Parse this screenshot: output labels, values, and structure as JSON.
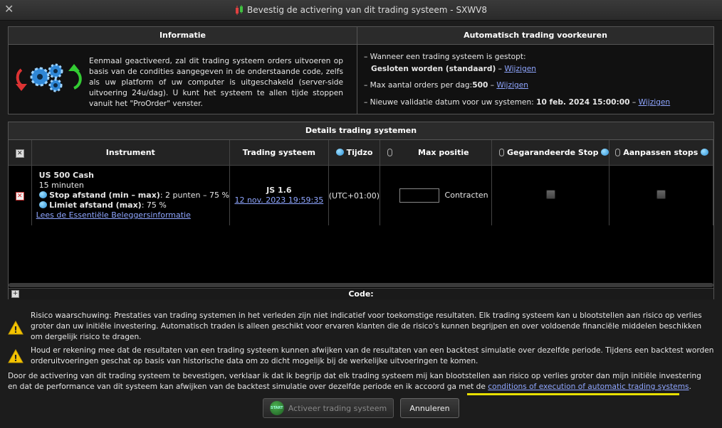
{
  "window": {
    "title": "Bevestig de activering van dit trading systeem - SXWV8"
  },
  "info": {
    "header": "Informatie",
    "text": "Eenmaal geactiveerd, zal dit trading systeem orders uitvoeren op basis van de condities aangegeven in de onderstaande code, zelfs als uw platform of uw computer is uitgeschakeld (server-side uitvoering 24u/dag). U kunt het systeem te allen tijde stoppen vanuit het \"ProOrder\" venster."
  },
  "prefs": {
    "header": "Automatisch trading voorkeuren",
    "stopped_label": "– Wanneer een trading systeem is gestopt:",
    "stopped_value": "Gesloten worden (standaard)",
    "max_orders_label": "– Max aantal orders per dag:",
    "max_orders_value": "500",
    "validation_label": "– Nieuwe validatie datum voor uw systemen:",
    "validation_value": "10 feb. 2024 15:00:00",
    "sep": " – ",
    "change_link": "Wijzigen"
  },
  "details": {
    "header": "Details trading systemen",
    "columns": {
      "instrument": "Instrument",
      "system": "Trading systeem",
      "timezone": "Tijdzo",
      "max_position": "Max positie",
      "guaranteed_stop": "Gegarandeerde Stop",
      "adjust_stops": "Aanpassen stops"
    },
    "row": {
      "instrument": "US 500 Cash",
      "interval": "15 minuten",
      "stop_label": "Stop afstand (min – max)",
      "stop_value": ": 2 punten – 75 %",
      "limit_label": "Limiet afstand (max)",
      "limit_value": ": 75 %",
      "info_link": "Lees de Essentiële Beleggersinformatie",
      "system_name": "JS 1.6",
      "system_date": "12 nov. 2023 19:59:35",
      "timezone": "(UTC+01:00)",
      "max_position_value": "",
      "unit": "Contracten"
    },
    "code_label": "Code:"
  },
  "warnings": {
    "risk": "Risico waarschuwing: Prestaties van trading systemen in het verleden zijn niet indicatief voor toekomstige resultaten. Elk trading systeem kan u blootstellen aan risico op verlies groter dan uw initiële investering. Automatisch traden is alleen geschikt voor ervaren klanten die de risico's kunnen begrijpen en over voldoende financiële middelen beschikken om dergelijk risico te dragen.",
    "backtest": "Houd er rekening mee dat de resultaten van een trading systeem kunnen afwijken van de resultaten van een backtest simulatie over dezelfde periode. Tijdens een backtest worden orderuitvoeringen geschat op basis van historische data om zo dicht mogelijk bij de werkelijke uitvoeringen te komen."
  },
  "agreement": {
    "text": "Door de activering van dit trading systeem te bevestigen, verklaar ik dat ik begrijp dat elk trading systeem mij kan blootstellen aan risico op verlies groter dan mijn initiële investering en dat de performance van dit systeem kan afwijken van de backtest simulatie over dezelfde periode en ik accoord ga met de ",
    "link": "conditions of execution of automatic trading systems",
    "end": "."
  },
  "buttons": {
    "start_icon_text": "START",
    "activate": "Activeer trading systeem",
    "cancel": "Annuleren"
  },
  "colors": {
    "highlight": "#e8e000",
    "link": "#8fa6ff",
    "warning": "#f5c400"
  }
}
